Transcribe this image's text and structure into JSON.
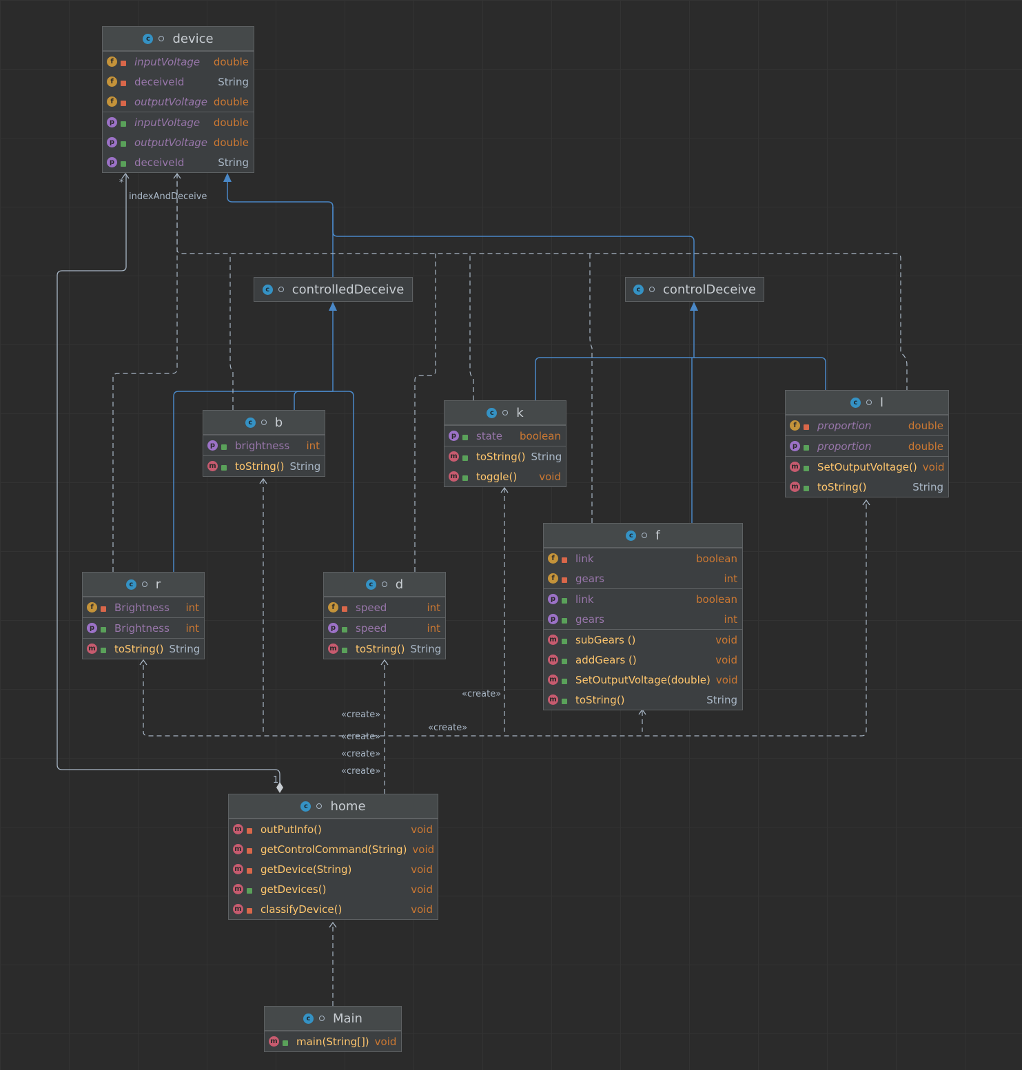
{
  "classes": {
    "device": {
      "name": "device",
      "rows": [
        {
          "kind": "f",
          "access": "private",
          "name": "inputVoltage",
          "type": "double"
        },
        {
          "kind": "f",
          "access": "private",
          "name": "deceiveId",
          "type": "String"
        },
        {
          "kind": "f",
          "access": "private",
          "name": "outputVoltage",
          "type": "double"
        },
        {
          "kind": "p",
          "access": "public",
          "name": "inputVoltage",
          "type": "double"
        },
        {
          "kind": "p",
          "access": "public",
          "name": "outputVoltage",
          "type": "double"
        },
        {
          "kind": "p",
          "access": "public",
          "name": "deceiveId",
          "type": "String"
        }
      ]
    },
    "controlledDeceive": {
      "name": "controlledDeceive"
    },
    "controlDeceive": {
      "name": "controlDeceive"
    },
    "b": {
      "name": "b",
      "rows": [
        {
          "kind": "p",
          "access": "public",
          "name": "brightness",
          "type": "int"
        },
        {
          "kind": "m",
          "access": "public",
          "name": "toString()",
          "type": "String"
        }
      ]
    },
    "k": {
      "name": "k",
      "rows": [
        {
          "kind": "p",
          "access": "public",
          "name": "state",
          "type": "boolean"
        },
        {
          "kind": "m",
          "access": "public",
          "name": "toString()",
          "type": "String"
        },
        {
          "kind": "m",
          "access": "public",
          "name": "toggle()",
          "type": "void"
        }
      ]
    },
    "l": {
      "name": "l",
      "rows": [
        {
          "kind": "f",
          "access": "private",
          "name": "proportion",
          "type": "double"
        },
        {
          "kind": "p",
          "access": "public",
          "name": "proportion",
          "type": "double"
        },
        {
          "kind": "m",
          "access": "public",
          "name": "SetOutputVoltage()",
          "type": "void"
        },
        {
          "kind": "m",
          "access": "public",
          "name": "toString()",
          "type": "String"
        }
      ]
    },
    "f": {
      "name": "f",
      "rows": [
        {
          "kind": "f",
          "access": "private",
          "name": "link",
          "type": "boolean"
        },
        {
          "kind": "f",
          "access": "private",
          "name": "gears",
          "type": "int"
        },
        {
          "kind": "p",
          "access": "public",
          "name": "link",
          "type": "boolean"
        },
        {
          "kind": "p",
          "access": "public",
          "name": "gears",
          "type": "int"
        },
        {
          "kind": "m",
          "access": "public",
          "name": "subGears ()",
          "type": "void"
        },
        {
          "kind": "m",
          "access": "public",
          "name": "addGears ()",
          "type": "void"
        },
        {
          "kind": "m",
          "access": "public",
          "name": "SetOutputVoltage(double)",
          "type": "void"
        },
        {
          "kind": "m",
          "access": "public",
          "name": "toString()",
          "type": "String"
        }
      ]
    },
    "r": {
      "name": "r",
      "rows": [
        {
          "kind": "f",
          "access": "private",
          "name": "Brightness",
          "type": "int"
        },
        {
          "kind": "p",
          "access": "public",
          "name": "Brightness",
          "type": "int"
        },
        {
          "kind": "m",
          "access": "public",
          "name": "toString()",
          "type": "String"
        }
      ]
    },
    "d": {
      "name": "d",
      "rows": [
        {
          "kind": "f",
          "access": "private",
          "name": "speed",
          "type": "int"
        },
        {
          "kind": "p",
          "access": "public",
          "name": "speed",
          "type": "int"
        },
        {
          "kind": "m",
          "access": "public",
          "name": "toString()",
          "type": "String"
        }
      ]
    },
    "home": {
      "name": "home",
      "rows": [
        {
          "kind": "m",
          "access": "private",
          "name": "outPutInfo()",
          "type": "void"
        },
        {
          "kind": "m",
          "access": "private",
          "name": "getControlCommand(String)",
          "type": "void"
        },
        {
          "kind": "m",
          "access": "private",
          "name": "getDevice(String)",
          "type": "void"
        },
        {
          "kind": "m",
          "access": "public",
          "name": "getDevices()",
          "type": "void"
        },
        {
          "kind": "m",
          "access": "private",
          "name": "classifyDevice()",
          "type": "void"
        }
      ]
    },
    "Main": {
      "name": "Main",
      "rows": [
        {
          "kind": "m",
          "access": "public",
          "name": "main(String[])",
          "type": "void"
        }
      ]
    }
  },
  "labels": {
    "association": "indexAndDeceive",
    "multiplicity_many": "*",
    "multiplicity_one": "1",
    "create": "«create»"
  },
  "colors": {
    "background": "#2b2b2b",
    "inheritance": "#4a88c7",
    "dependency": "#a9b7c6",
    "field_icon": "#c4933a",
    "property_icon": "#9c72c7",
    "method_icon": "#c75b6f",
    "class_icon": "#3592c4"
  }
}
